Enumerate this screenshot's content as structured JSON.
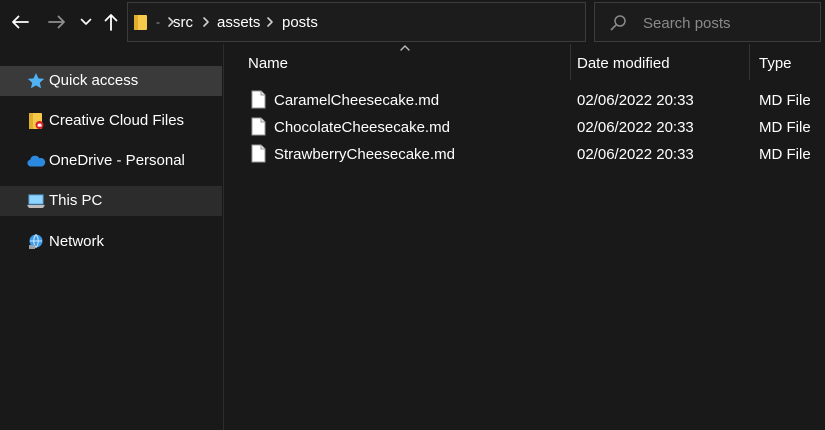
{
  "toolbar": {
    "back_icon": "arrow-left-icon",
    "forward_icon": "arrow-right-icon",
    "recent_icon": "chevron-down-icon",
    "up_icon": "arrow-up-icon"
  },
  "address": {
    "folder_icon": "folder-icon",
    "separator_first": "-",
    "crumbs": [
      "src",
      "assets",
      "posts"
    ],
    "dropdown_icon": "chevron-down-icon",
    "refresh_icon": "refresh-icon"
  },
  "search": {
    "placeholder": "Search posts",
    "value": "",
    "icon": "search-icon"
  },
  "sidebar": {
    "items": [
      {
        "label": "Quick access",
        "icon": "star-icon",
        "state": "selected"
      },
      {
        "label": "Creative Cloud Files",
        "icon": "creative-cloud-folder-icon",
        "state": "normal"
      },
      {
        "label": "OneDrive - Personal",
        "icon": "onedrive-cloud-icon",
        "state": "normal"
      },
      {
        "label": "This PC",
        "icon": "computer-icon",
        "state": "hovered"
      },
      {
        "label": "Network",
        "icon": "network-icon",
        "state": "normal"
      }
    ]
  },
  "columns": {
    "name": "Name",
    "date_modified": "Date modified",
    "type": "Type",
    "sorted_by": "Name",
    "sort_icon": "sort-up-icon"
  },
  "files": [
    {
      "name": "CaramelCheesecake.md",
      "date_modified": "02/06/2022 20:33",
      "type": "MD File",
      "icon": "document-icon"
    },
    {
      "name": "ChocolateCheesecake.md",
      "date_modified": "02/06/2022 20:33",
      "type": "MD File",
      "icon": "document-icon"
    },
    {
      "name": "StrawberryCheesecake.md",
      "date_modified": "02/06/2022 20:33",
      "type": "MD File",
      "icon": "document-icon"
    }
  ],
  "colors": {
    "background": "#191919",
    "selected_item": "#3a3a3a",
    "hover_item": "#2c2c2c",
    "border": "#3c3c3c",
    "folder_yellow": "#f7c94b",
    "star_blue": "#4fb3f6",
    "onedrive_blue": "#2b8ae0"
  }
}
